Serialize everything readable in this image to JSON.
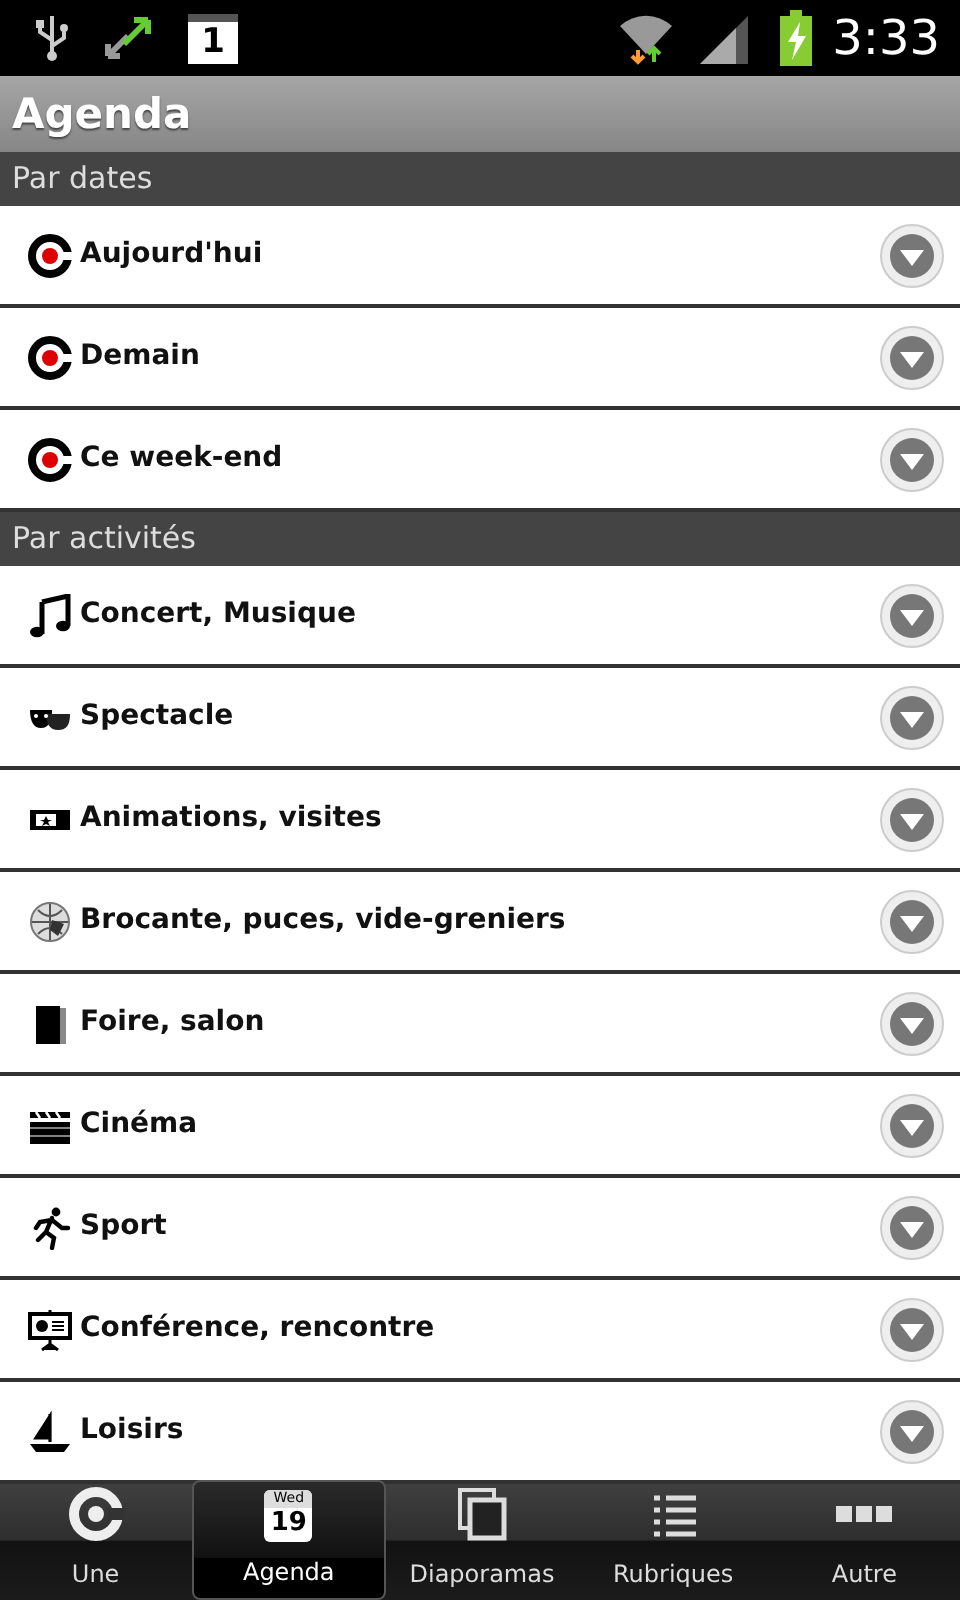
{
  "status_bar": {
    "notification_badge": "1",
    "time": "3:33"
  },
  "title": "Agenda",
  "sections": [
    {
      "title": "Par dates",
      "items": [
        {
          "label": "Aujourd'hui"
        },
        {
          "label": "Demain"
        },
        {
          "label": "Ce week-end"
        }
      ]
    },
    {
      "title": "Par activités",
      "items": [
        {
          "label": "Concert, Musique"
        },
        {
          "label": "Spectacle"
        },
        {
          "label": "Animations, visites"
        },
        {
          "label": "Brocante, puces, vide-greniers"
        },
        {
          "label": "Foire, salon"
        },
        {
          "label": "Cinéma"
        },
        {
          "label": "Sport"
        },
        {
          "label": "Conférence, rencontre"
        },
        {
          "label": "Loisirs"
        }
      ]
    }
  ],
  "tabs": [
    {
      "label": "Une",
      "selected": false
    },
    {
      "label": "Agenda",
      "selected": true,
      "calendar_day": "Wed",
      "calendar_date": "19"
    },
    {
      "label": "Diaporamas",
      "selected": false
    },
    {
      "label": "Rubriques",
      "selected": false
    },
    {
      "label": "Autre",
      "selected": false
    }
  ]
}
